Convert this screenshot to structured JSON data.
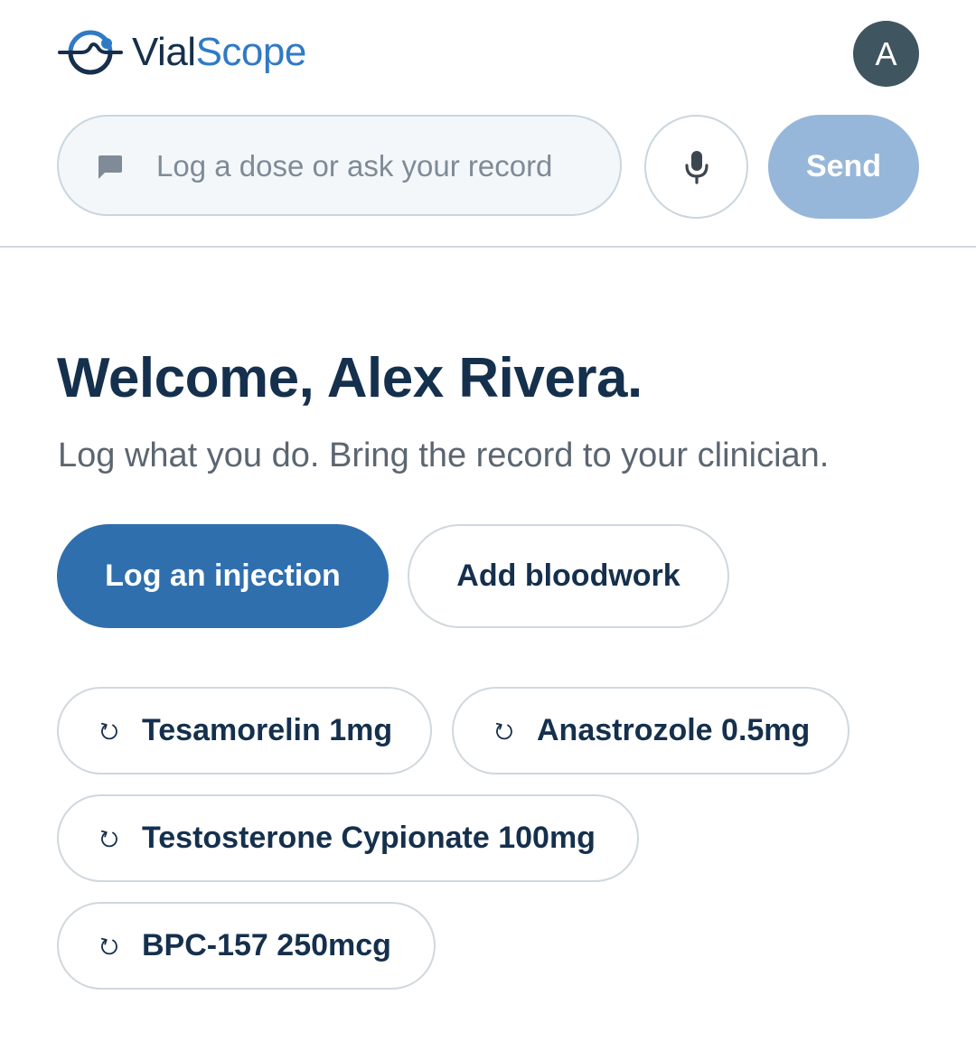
{
  "header": {
    "brand_part1": "Vial",
    "brand_part2": "Scope",
    "logo_icon": "vial-scope-logo-icon",
    "avatar_initial": "A"
  },
  "composer": {
    "placeholder": "Log a dose or ask your record",
    "value": "",
    "chat_icon": "chat-bubble-icon",
    "mic_icon": "microphone-icon",
    "send_label": "Send"
  },
  "welcome": {
    "title": "Welcome, Alex Rivera.",
    "subtitle": "Log what you do. Bring the record to your clinician."
  },
  "actions": {
    "primary_label": "Log an injection",
    "secondary_label": "Add bloodwork"
  },
  "quick_logs": [
    {
      "label": "Tesamorelin 1mg",
      "icon": "repeat-icon"
    },
    {
      "label": "Anastrozole 0.5mg",
      "icon": "repeat-icon"
    },
    {
      "label": "Testosterone Cypionate 100mg",
      "icon": "repeat-icon"
    },
    {
      "label": "BPC-157 250mcg",
      "icon": "repeat-icon"
    }
  ],
  "colors": {
    "brand_dark": "#162f4c",
    "brand_accent": "#2f7ac5",
    "primary_button": "#2f6fae",
    "send_button_disabled": "#97b7da",
    "avatar_bg": "#3f5560",
    "border": "#cfd8de"
  }
}
